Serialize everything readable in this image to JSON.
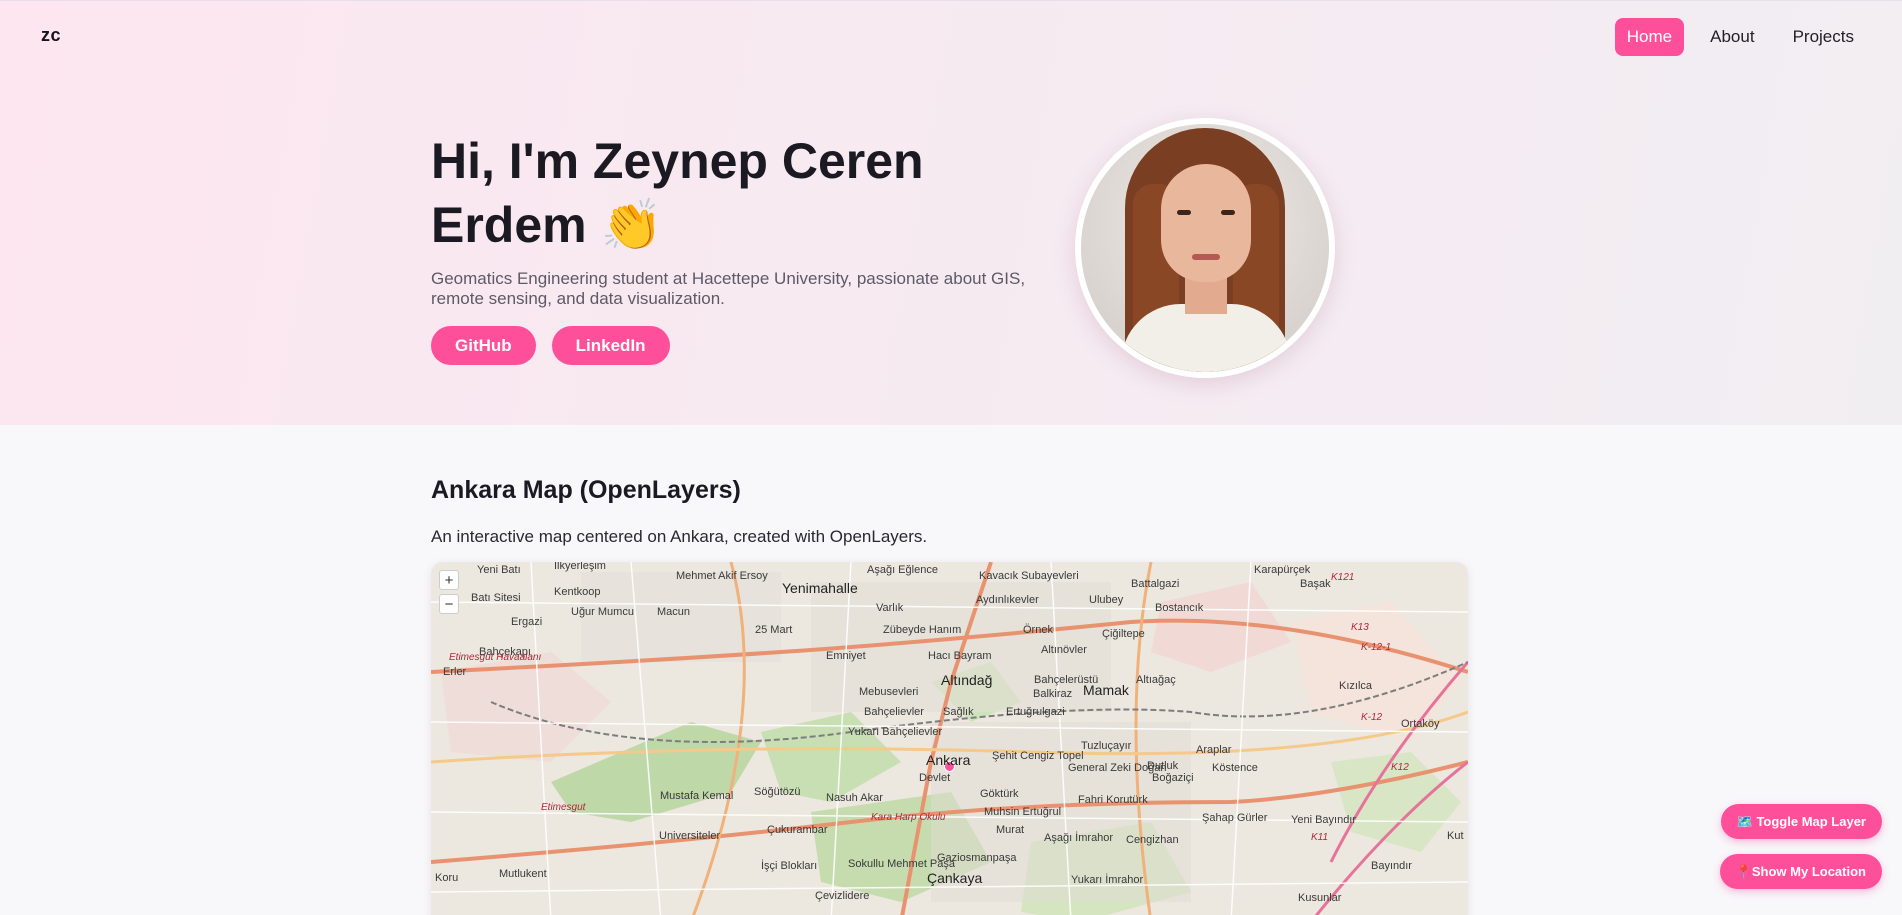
{
  "header": {
    "logo": "zc",
    "nav": [
      {
        "label": "Home",
        "active": true
      },
      {
        "label": "About",
        "active": false
      },
      {
        "label": "Projects",
        "active": false
      }
    ]
  },
  "hero": {
    "title": "Hi, I'm Zeynep Ceren Erdem 👏",
    "subtitle": "Geomatics Engineering student at Hacettepe University, passionate about GIS, remote sensing, and data visualization.",
    "buttons": [
      {
        "label": "GitHub"
      },
      {
        "label": "LinkedIn"
      }
    ]
  },
  "map_section": {
    "title": "Ankara Map (OpenLayers)",
    "description": "An interactive map centered on Ankara, created with OpenLayers.",
    "zoom_in": "+",
    "zoom_out": "−",
    "labels": [
      "Yeni Batı",
      "İlkyerleşim",
      "Mehmet Akif Ersoy",
      "Yenimahalle",
      "Aşağı Eğlence",
      "Kavacık Subayevleri",
      "Battalgazi",
      "Karapürçek",
      "Başak",
      "Batı Sitesi",
      "Kentkoop",
      "Uğur Mumcu",
      "Macun",
      "Varlık",
      "Aydınlıkevler",
      "Ulubey",
      "Bostancık",
      "Ergazi",
      "25 Mart",
      "Zübeyde Hanım",
      "Örnek",
      "Çiğiltepe",
      "Bahçekapı",
      "Emniyet",
      "Hacı Bayram",
      "Altınövler",
      "Erler",
      "Mebusevleri",
      "Altındağ",
      "Bahçelerüstü",
      "Altıağaç",
      "Balkiraz",
      "Mamak",
      "Bahçelievler",
      "Sağlık",
      "Ertuğrulgazi",
      "Yukarı Bahçelievler",
      "Ankara",
      "Şehit Cengiz Topel",
      "Tuzluçayır",
      "Araplar",
      "Dutluk",
      "Köstence",
      "Ortaköy",
      "Kızılca",
      "General Zeki Doğan",
      "Boğaziçi",
      "Devlet",
      "Mustafa Kemal",
      "Söğütözü",
      "Nasuh Akar",
      "Göktürk",
      "Muhsin Ertuğrul",
      "Fahri Korutürk",
      "Şahap Gürler",
      "Yeni Bayındır",
      "Universiteler",
      "Çukurambar",
      "Murat",
      "Aşağı İmrahor",
      "Cengizhan",
      "İşçi Blokları",
      "Sokullu Mehmet Paşa",
      "Gaziosmanpaşa",
      "Koru",
      "Mutlukent",
      "Çankaya",
      "Yukarı İmrahor",
      "Çevizlidere",
      "Kusunlar",
      "Bayındır",
      "Kut"
    ],
    "road_labels": [
      "K121",
      "K13",
      "K-12-1",
      "K-12",
      "K11",
      "K12",
      "Etimesgut Havaalanı",
      "Kara Harp Okulu",
      "Etimesgut"
    ]
  },
  "floating": {
    "toggle_layer": "🗺️ Toggle Map Layer",
    "show_location": "📍Show My Location"
  },
  "colors": {
    "accent": "#fd4f9a",
    "hero_bg_start": "#fde6f0",
    "page_bg": "#f8f7fa"
  }
}
